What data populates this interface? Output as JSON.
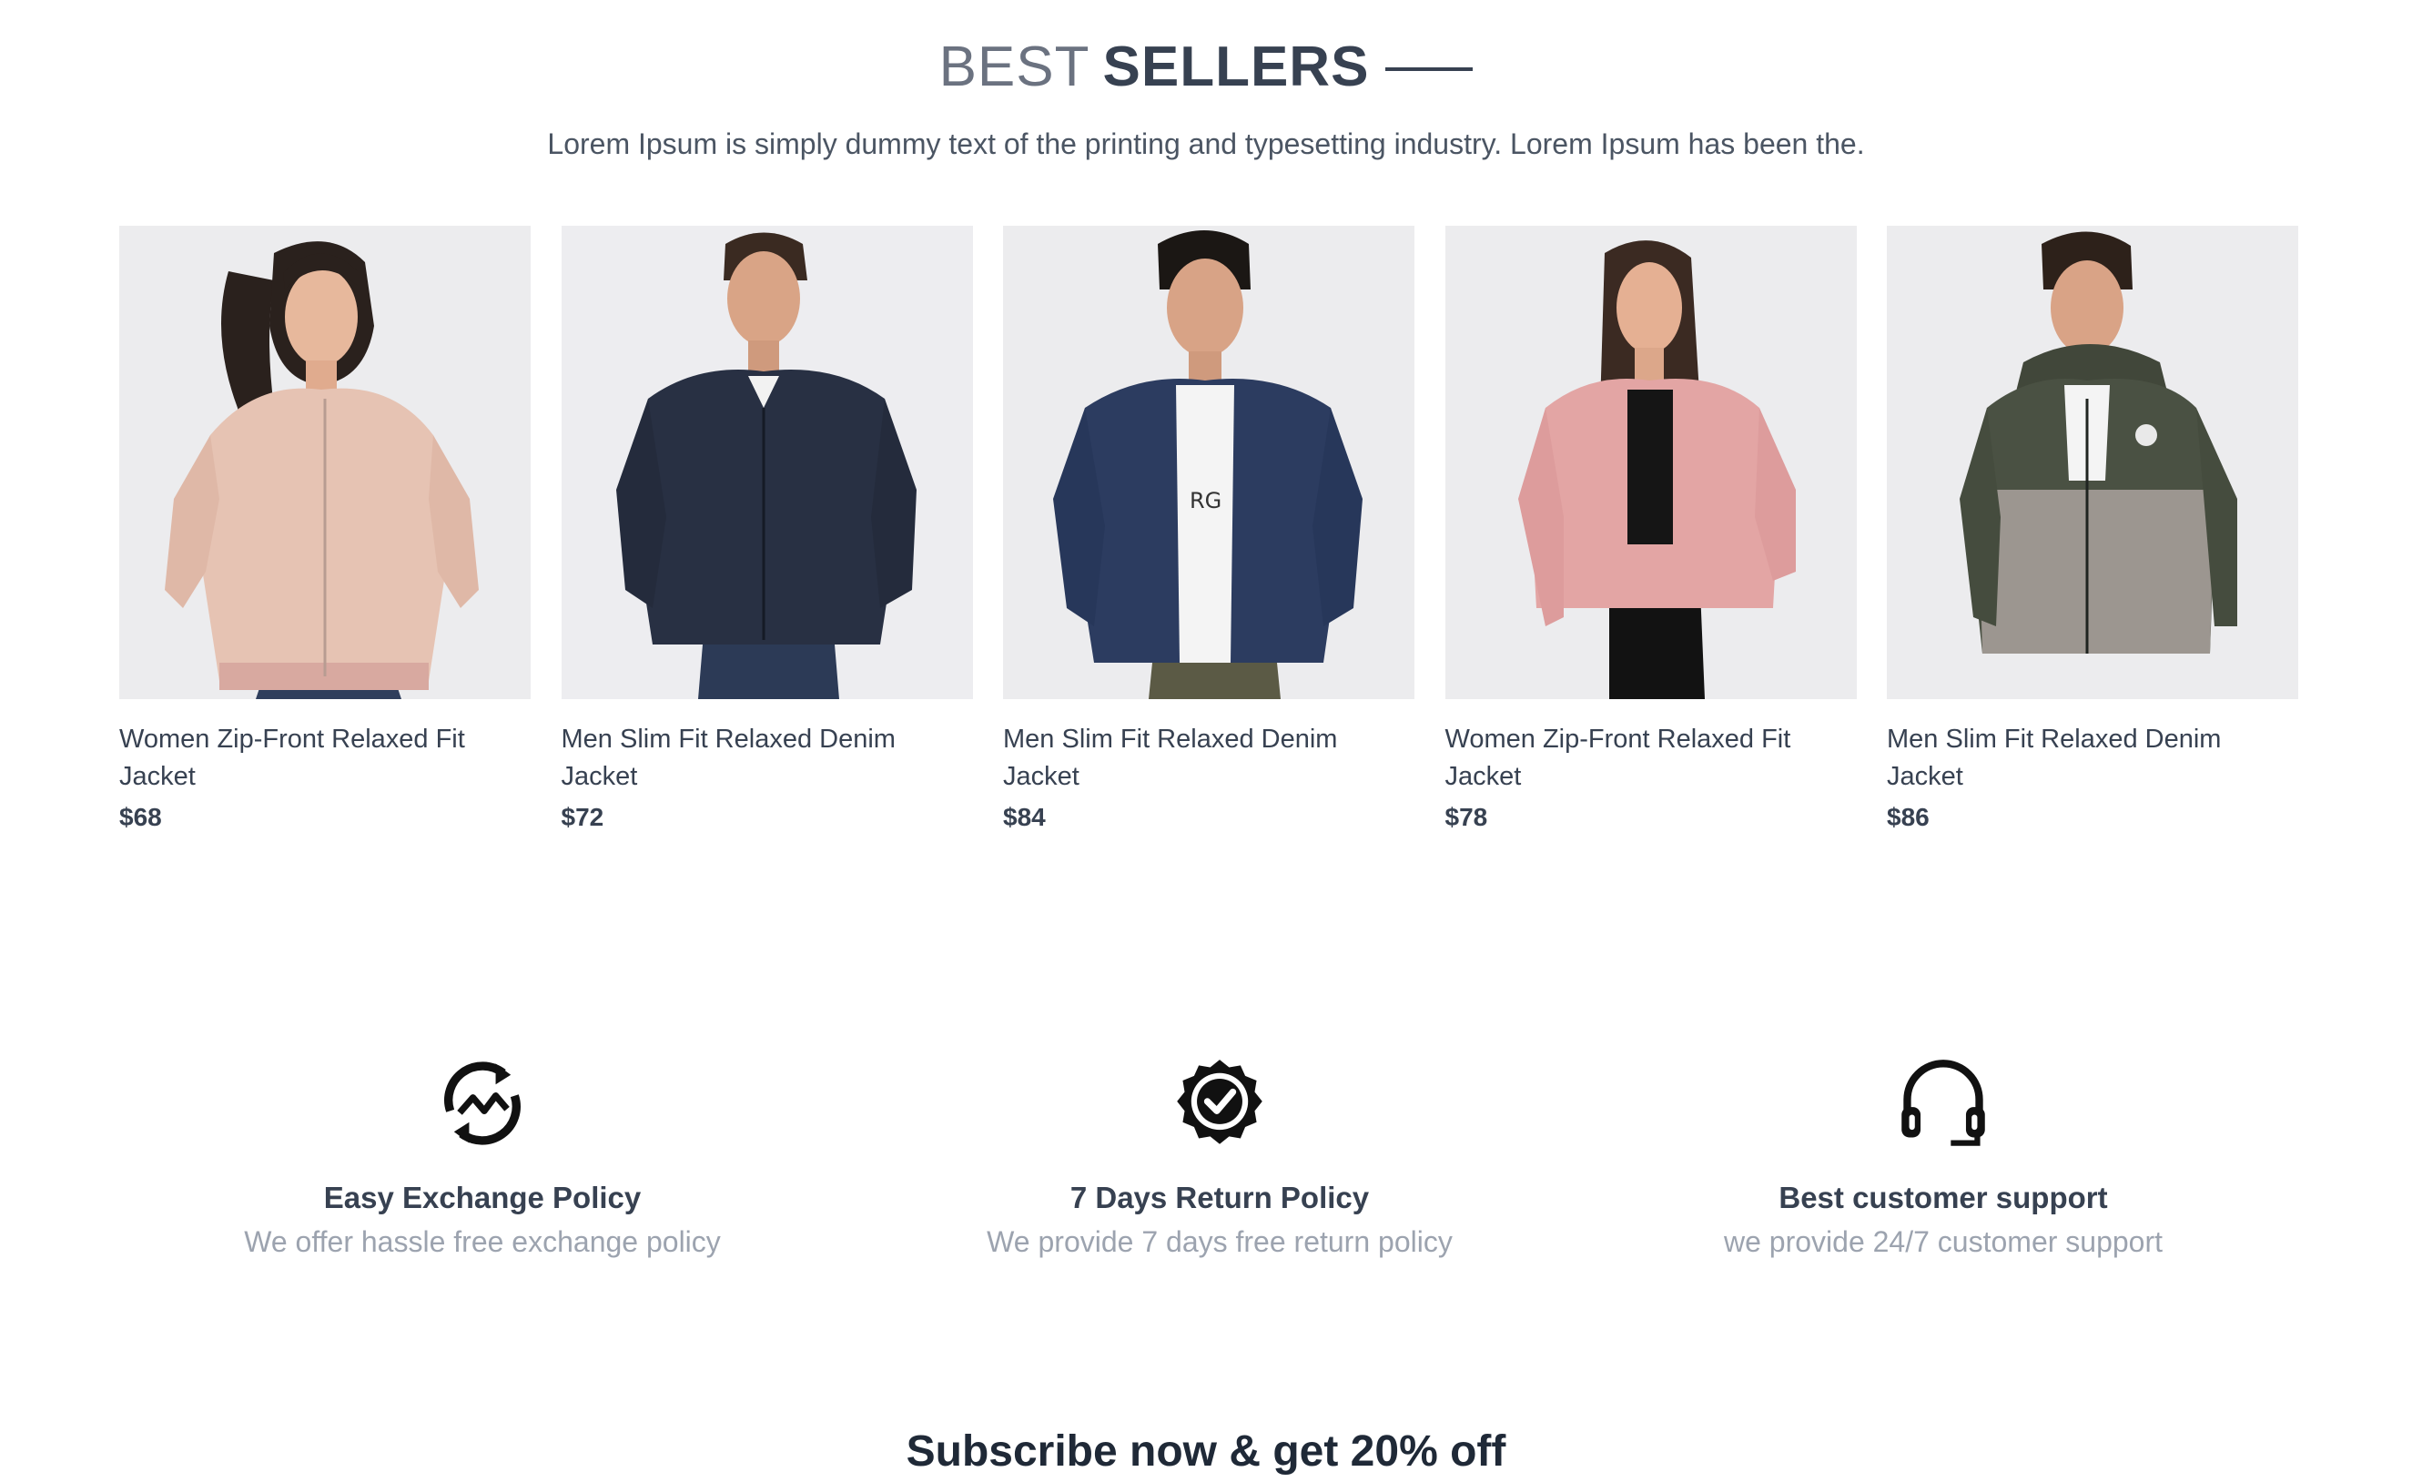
{
  "header": {
    "title_light": "BEST",
    "title_bold": "SELLERS",
    "subtitle": "Lorem Ipsum is simply dummy text of the printing and typesetting industry. Lorem Ipsum has been the."
  },
  "products": [
    {
      "name": "Women Zip-Front Relaxed Fit Jacket",
      "price": "$68"
    },
    {
      "name": "Men Slim Fit Relaxed Denim Jacket",
      "price": "$72"
    },
    {
      "name": "Men Slim Fit Relaxed Denim Jacket",
      "price": "$84"
    },
    {
      "name": "Women Zip-Front Relaxed Fit Jacket",
      "price": "$78"
    },
    {
      "name": "Men Slim Fit Relaxed Denim Jacket",
      "price": "$86"
    }
  ],
  "policies": [
    {
      "icon": "exchange-icon",
      "title": "Easy Exchange Policy",
      "description": "We offer hassle free exchange policy"
    },
    {
      "icon": "quality-badge-icon",
      "title": "7 Days Return Policy",
      "description": "We provide 7 days free return policy"
    },
    {
      "icon": "headset-icon",
      "title": "Best customer support",
      "description": "we provide 24/7 customer support"
    }
  ],
  "subscribe": {
    "heading": "Subscribe now & get 20% off"
  },
  "colors": {
    "text_dark": "#374151",
    "text_muted": "#9ca3af",
    "title_light": "#6b7280",
    "photo_background": "#ececee"
  }
}
